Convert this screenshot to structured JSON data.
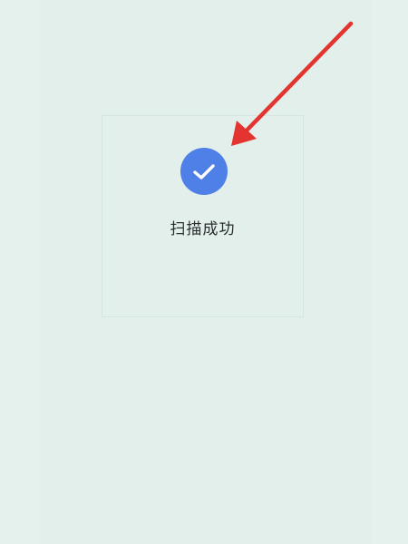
{
  "scan_result": {
    "status_text": "扫描成功",
    "icon": "check-icon"
  },
  "colors": {
    "background": "#e4f1ec",
    "icon_circle": "#4f80e8",
    "annotation_arrow": "#e3342f"
  }
}
